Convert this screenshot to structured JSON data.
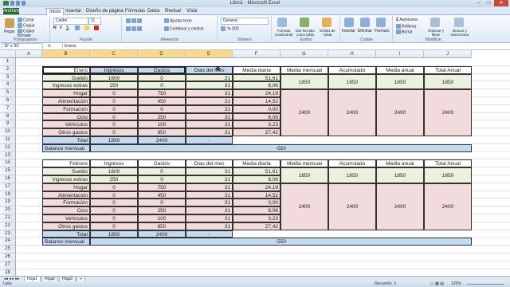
{
  "window": {
    "title": "Libro1 - Microsoft Excel"
  },
  "tabs": [
    "Archivo",
    "Inicio",
    "Insertar",
    "Diseño de página",
    "Fórmulas",
    "Datos",
    "Revisar",
    "Vista"
  ],
  "ribbon": {
    "clipboard": {
      "paste": "Pegar",
      "cut": "Cortar",
      "copy": "Copiar",
      "format": "Copiar formato",
      "label": "Portapapeles"
    },
    "font": {
      "name": "Calibri",
      "size": "11",
      "label": "Fuente"
    },
    "alignment": {
      "wrap": "Ajustar texto",
      "merge": "Combinar y centrar",
      "label": "Alineación"
    },
    "number": {
      "format": "General",
      "label": "Número"
    },
    "styles": {
      "cond": "Formato condicional",
      "table": "Dar formato como tabla",
      "cell": "Estilos de celda",
      "label": "Estilos"
    },
    "cells": {
      "insert": "Insertar",
      "delete": "Eliminar",
      "format": "Formato",
      "label": "Celdas"
    },
    "editing": {
      "autosum": "Autosuma",
      "fill": "Rellenar",
      "clear": "Borrar",
      "sort": "Ordenar y filtrar",
      "find": "Buscar y seleccionar",
      "label": "Modificar"
    }
  },
  "formula_bar": {
    "name_box": "1F x 3C",
    "fx": "fx",
    "value": "Enero"
  },
  "columns": [
    "B",
    "C",
    "D",
    "E",
    "F",
    "G",
    "H",
    "I",
    "J"
  ],
  "rows": [
    "1",
    "2",
    "3",
    "4",
    "5",
    "6",
    "7",
    "8",
    "9",
    "10",
    "11",
    "12",
    "13",
    "14",
    "15",
    "16",
    "17",
    "18",
    "19",
    "20",
    "21",
    "22",
    "23",
    "24",
    "25",
    "26",
    "27",
    "28"
  ],
  "block1": {
    "header": [
      "Enero",
      "Ingresos",
      "Gastos",
      "Días del mes",
      "Media diaria",
      "Media mensual",
      "Acumulado",
      "Media anual",
      "Total Anual"
    ],
    "rows": [
      [
        "Sueldo",
        "1600",
        "0",
        "31",
        "51,61"
      ],
      [
        "Ingresos extras",
        "250",
        "0",
        "31",
        "8,06"
      ],
      [
        "Hogar",
        "0",
        "750",
        "31",
        "24,19"
      ],
      [
        "Alimentación",
        "0",
        "450",
        "31",
        "14,52"
      ],
      [
        "Formación",
        "0",
        "0",
        "31",
        "0,00"
      ],
      [
        "Ocio",
        "0",
        "250",
        "31",
        "8,06"
      ],
      [
        "Vehículos",
        "0",
        "100",
        "31",
        "3,23"
      ],
      [
        "Otros gastos",
        "0",
        "850",
        "31",
        "27,42"
      ]
    ],
    "income_summary": [
      "1850",
      "1850",
      "1850",
      "1850"
    ],
    "expense_summary": [
      "2400",
      "2400",
      "2400",
      "2400"
    ],
    "total": {
      "label": "Total",
      "ingresos": "1850",
      "gastos": "2400",
      "dias": "-"
    },
    "balance": {
      "label": "Balance mensual",
      "value": "-550"
    }
  },
  "block2": {
    "header": [
      "Febrero",
      "Ingresos",
      "Gastos",
      "Días del mes",
      "Media diaria",
      "Media mensual",
      "Acumulado",
      "Media anual",
      "Total Anual"
    ],
    "rows": [
      [
        "Sueldo",
        "1600",
        "0",
        "31",
        "51,61"
      ],
      [
        "Ingresos extras",
        "250",
        "0",
        "31",
        "8,06"
      ],
      [
        "Hogar",
        "0",
        "750",
        "31",
        "24,19"
      ],
      [
        "Alimentación",
        "0",
        "450",
        "31",
        "14,52"
      ],
      [
        "Formación",
        "0",
        "0",
        "31",
        "0,00"
      ],
      [
        "Ocio",
        "0",
        "250",
        "31",
        "8,06"
      ],
      [
        "Vehículos",
        "0",
        "100",
        "31",
        "3,23"
      ],
      [
        "Otros gastos",
        "0",
        "850",
        "31",
        "27,42"
      ]
    ],
    "income_summary": [
      "1850",
      "1850",
      "1850",
      "1850"
    ],
    "expense_summary": [
      "2400",
      "2400",
      "2400",
      "2400"
    ],
    "total": {
      "label": "Total",
      "ingresos": "1850",
      "gastos": "2400",
      "dias": "-"
    },
    "balance": {
      "label": "Balance mensual",
      "value": "-550"
    }
  },
  "sheets": [
    "Hoja1",
    "Hoja2",
    "Hoja3"
  ],
  "status": {
    "left": "Listo",
    "count": "Recuento: 3",
    "zoom": "120%"
  },
  "colors": {
    "blue_header": "#c5d9f1",
    "green": "#ebf1de",
    "pink": "#f2dcdb",
    "ribbon": "#dde8f5"
  }
}
